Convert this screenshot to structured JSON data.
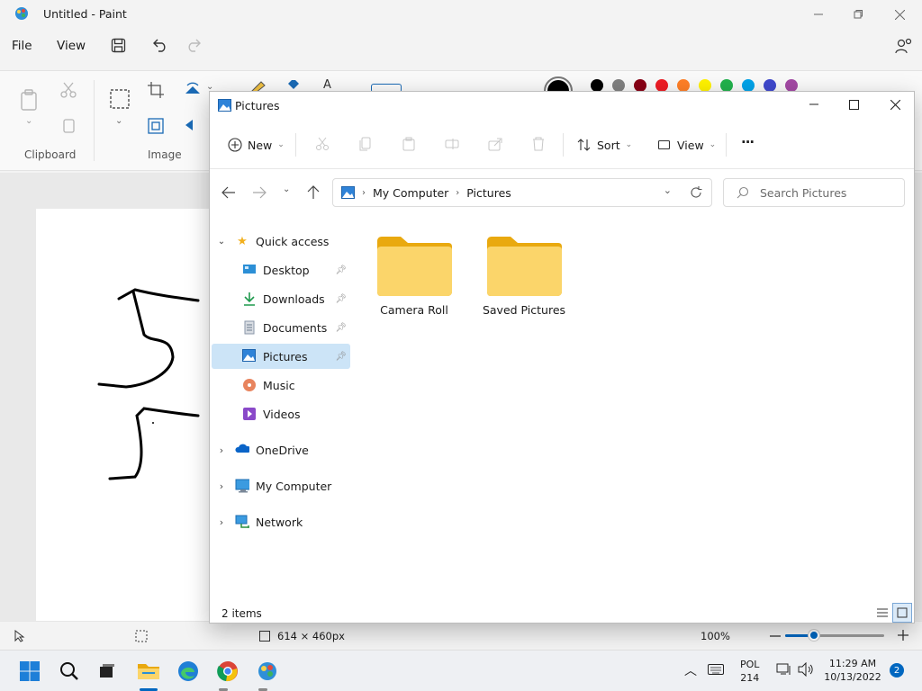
{
  "paint": {
    "title": "Untitled - Paint",
    "menu": {
      "file": "File",
      "view": "View"
    },
    "ribbon": {
      "clipboard_label": "Clipboard",
      "image_label": "Image"
    },
    "colors": [
      "#000000",
      "#7f7f7f",
      "#880015",
      "#ed1c24",
      "#ff7f27",
      "#fff200",
      "#22b14c",
      "#00a2e8",
      "#3f48cc",
      "#a349a4"
    ],
    "status": {
      "canvas_size": "614 × 460px",
      "zoom": "100%"
    }
  },
  "explorer": {
    "title": "Pictures",
    "toolbar": {
      "new_label": "New",
      "sort_label": "Sort",
      "view_label": "View",
      "more_label": "···"
    },
    "address": {
      "root": "My Computer",
      "current": "Pictures"
    },
    "search_placeholder": "Search Pictures",
    "nav": {
      "quick_access": "Quick access",
      "items": [
        {
          "label": "Desktop",
          "icon": "desktop-icon",
          "pinned": true
        },
        {
          "label": "Downloads",
          "icon": "download-icon",
          "pinned": true
        },
        {
          "label": "Documents",
          "icon": "document-icon",
          "pinned": true
        },
        {
          "label": "Pictures",
          "icon": "pictures-icon",
          "pinned": true
        },
        {
          "label": "Music",
          "icon": "music-icon",
          "pinned": false
        },
        {
          "label": "Videos",
          "icon": "video-icon",
          "pinned": false
        }
      ],
      "onedrive": "OneDrive",
      "my_computer": "My Computer",
      "network": "Network"
    },
    "folders": [
      {
        "name": "Camera Roll"
      },
      {
        "name": "Saved Pictures"
      }
    ],
    "status": {
      "item_count": "2 items"
    }
  },
  "taskbar": {
    "lang_top": "POL",
    "lang_bottom": "214",
    "time": "11:29 AM",
    "date": "10/13/2022",
    "notifications": "2"
  },
  "colors": {
    "accent": "#0067c0",
    "folder": "#f8c84a",
    "selection": "#cce4f7"
  }
}
